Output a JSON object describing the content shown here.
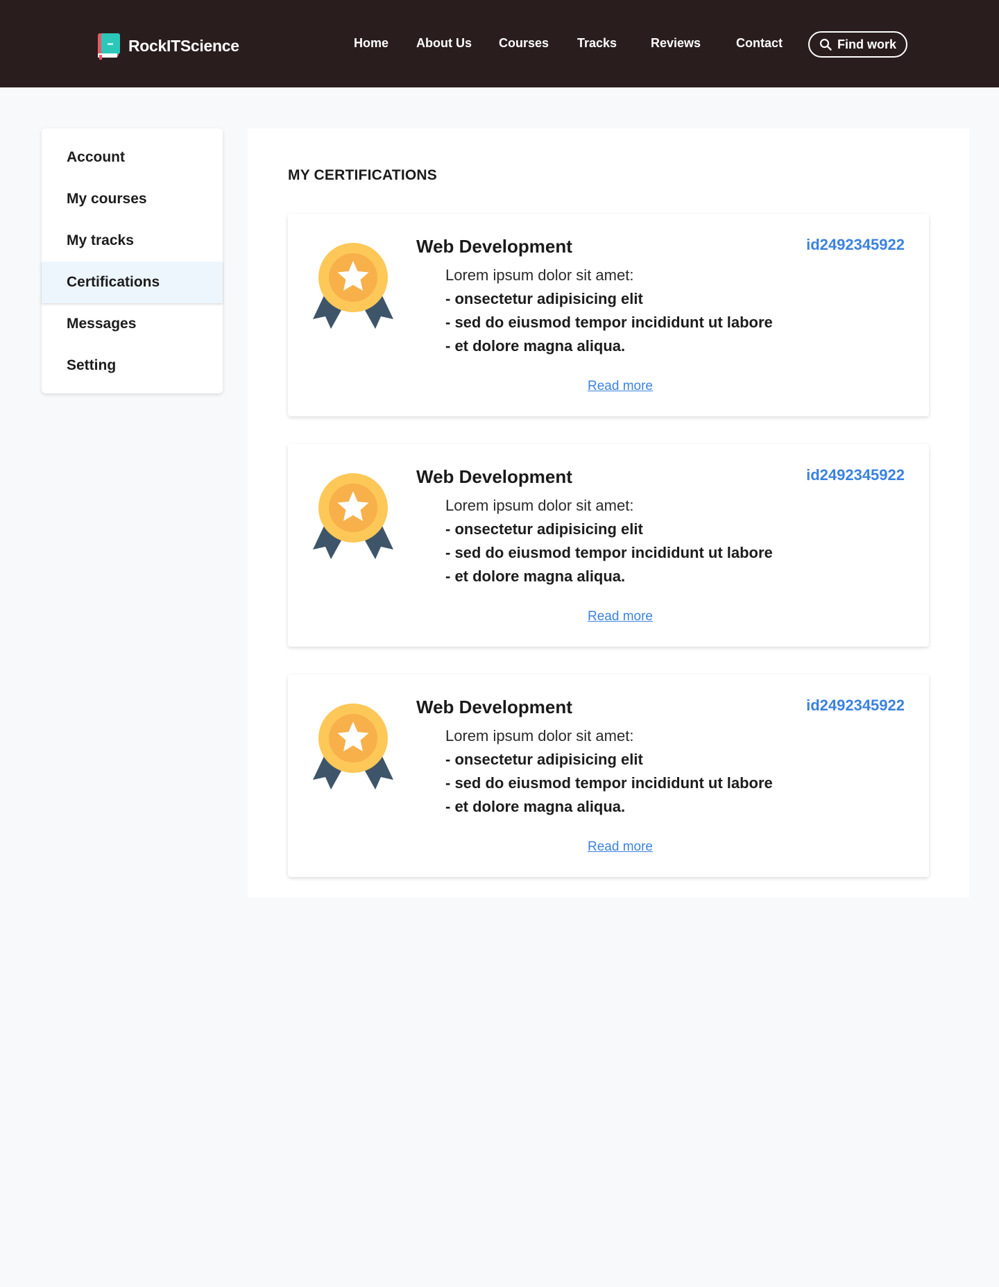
{
  "header": {
    "brand": "RockITScience",
    "nav": [
      "Home",
      "About Us",
      "Courses",
      "Tracks",
      "Reviews",
      "Contact"
    ],
    "find_work": "Find work"
  },
  "sidebar": {
    "items": [
      {
        "label": "Account"
      },
      {
        "label": "My courses"
      },
      {
        "label": "My tracks"
      },
      {
        "label": "Certifications",
        "active": true
      },
      {
        "label": "Messages"
      },
      {
        "label": "Setting"
      }
    ]
  },
  "main": {
    "title": "MY CERTIFICATIONS",
    "certificates": [
      {
        "title": "Web Development",
        "id": "id2492345922",
        "intro": "Lorem ipsum dolor sit amet:",
        "points": [
          "- onsectetur adipisicing elit",
          "- sed do eiusmod tempor incididunt ut labore",
          "- et dolore magna aliqua."
        ],
        "read_more": "Read more"
      },
      {
        "title": "Web Development",
        "id": "id2492345922",
        "intro": "Lorem ipsum dolor sit amet:",
        "points": [
          "- onsectetur adipisicing elit",
          "- sed do eiusmod tempor incididunt ut labore",
          "- et dolore magna aliqua."
        ],
        "read_more": "Read more"
      },
      {
        "title": "Web Development",
        "id": "id2492345922",
        "intro": "Lorem ipsum dolor sit amet:",
        "points": [
          "- onsectetur adipisicing elit",
          "- sed do eiusmod tempor incididunt ut labore",
          "- et dolore magna aliqua."
        ],
        "read_more": "Read more"
      }
    ]
  },
  "colors": {
    "header_bg": "#2a1d1e",
    "page_bg": "#f7f9fb",
    "accent": "#3b82e0",
    "active_item_bg": "#eef6fd",
    "medal_gold": "#fdc858",
    "medal_inner": "#f8b04b",
    "ribbon": "#3e5569"
  },
  "icons": {
    "logo": "book-icon",
    "find_work": "search-icon",
    "certificate": "medal-icon"
  }
}
